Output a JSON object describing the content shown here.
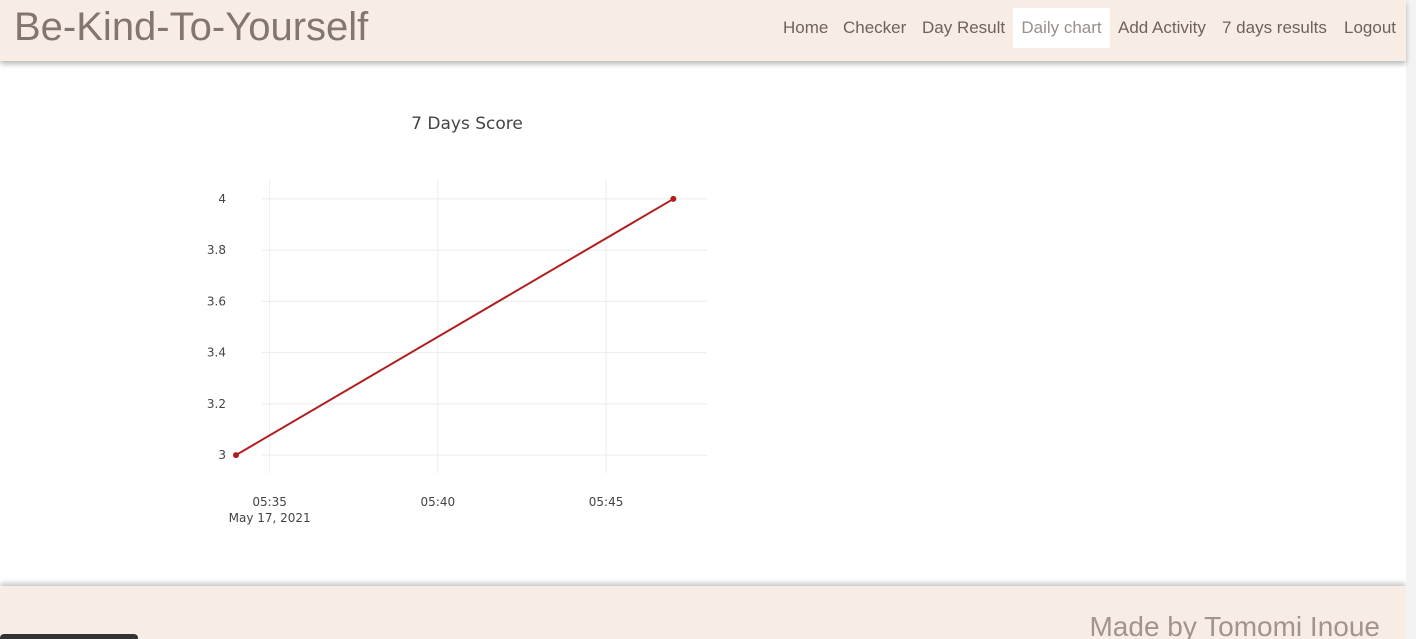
{
  "header": {
    "brand": "Be-Kind-To-Yourself",
    "nav": [
      {
        "label": "Home",
        "active": false
      },
      {
        "label": "Checker",
        "active": false
      },
      {
        "label": "Day Result",
        "active": false
      },
      {
        "label": "Daily chart",
        "active": true
      },
      {
        "label": "Add Activity",
        "active": false
      },
      {
        "label": "7 days results",
        "active": false
      },
      {
        "label": "Logout",
        "active": false
      }
    ]
  },
  "chart_data": {
    "type": "line",
    "title": "7 Days Score",
    "x": [
      "2021-05-17 05:34",
      "2021-05-17 05:47"
    ],
    "y": [
      3,
      4
    ],
    "xlabel": "",
    "ylabel": "",
    "xlim": [
      "2021-05-17 05:34",
      "2021-05-17 05:48"
    ],
    "ylim": [
      2.93,
      4.07
    ],
    "x_ticks": [
      "05:35",
      "05:40",
      "05:45"
    ],
    "x_tick_sub": "May 17, 2021",
    "y_ticks": [
      "3",
      "3.2",
      "3.4",
      "3.6",
      "3.8",
      "4"
    ],
    "y_tick_values": [
      3,
      3.2,
      3.4,
      3.6,
      3.8,
      4
    ],
    "line_color": "#b01e1e",
    "grid": true
  },
  "footer": {
    "text": "Made by Tomomi Inoue"
  }
}
